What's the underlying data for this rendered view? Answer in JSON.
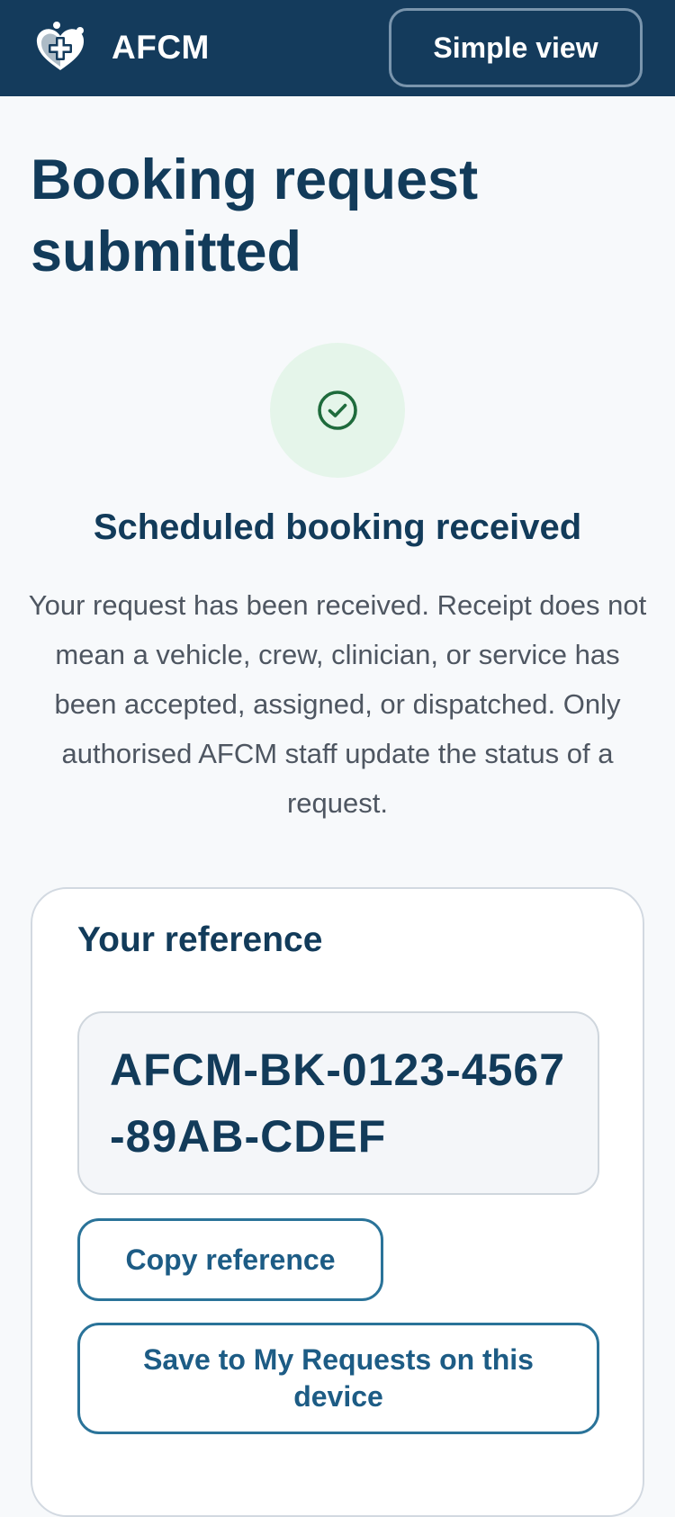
{
  "header": {
    "brand": "AFCM",
    "logo_icon": "heart-cross-logo-icon",
    "simple_view_label": "Simple view",
    "background_color": "#143b5c"
  },
  "main": {
    "title": "Booking request submitted",
    "status_icon": "check-circle-icon",
    "status_heading": "Scheduled booking received",
    "status_message": "Your request has been received. Receipt does not mean a vehicle, crew, clinician, or service has been accepted, assigned, or dispatched. Only authorised AFCM staff update the status of a request.",
    "success_color": "#1e6b3c"
  },
  "reference_card": {
    "label": "Your reference",
    "value": "AFCM-BK-0123-4567-89AB-CDEF",
    "copy_label": "Copy reference",
    "save_label": "Save to My Requests on this device",
    "accent_color": "#2a7399"
  }
}
